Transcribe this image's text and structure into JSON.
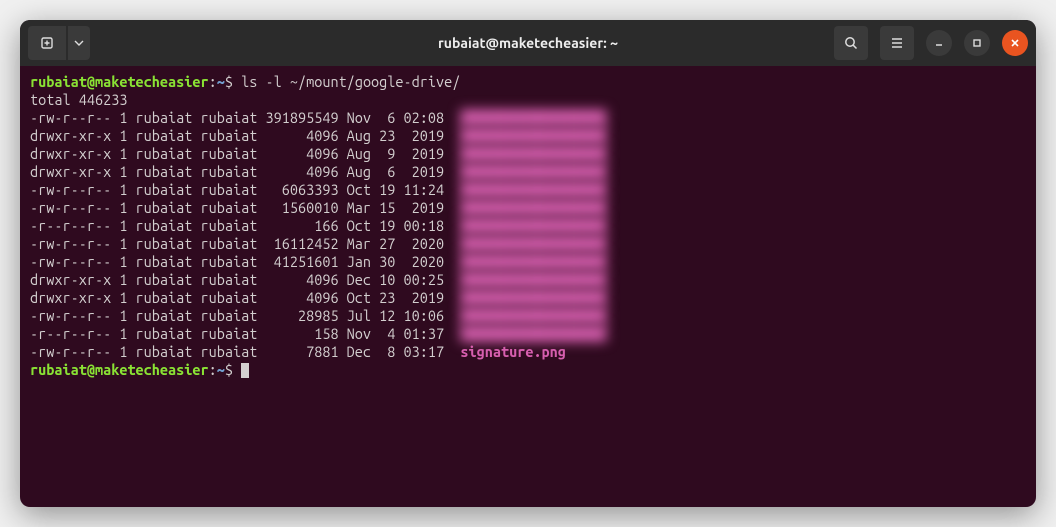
{
  "window": {
    "title": "rubaiat@maketecheasier: ~"
  },
  "prompt": {
    "user": "rubaiat@maketecheasier",
    "path": "~",
    "symbol": "$"
  },
  "command1": "ls -l ~/mount/google-drive/",
  "totalLine": "total 446233",
  "rows": [
    {
      "perm": "-rw-r--r--",
      "n": "1",
      "o": "rubaiat",
      "g": "rubaiat",
      "size": "391895549",
      "m": "Nov",
      "d": " 6",
      "t": "02:08",
      "blurred": true
    },
    {
      "perm": "drwxr-xr-x",
      "n": "1",
      "o": "rubaiat",
      "g": "rubaiat",
      "size": "4096",
      "m": "Aug",
      "d": "23",
      "t": " 2019",
      "blurred": true
    },
    {
      "perm": "drwxr-xr-x",
      "n": "1",
      "o": "rubaiat",
      "g": "rubaiat",
      "size": "4096",
      "m": "Aug",
      "d": " 9",
      "t": " 2019",
      "blurred": true
    },
    {
      "perm": "drwxr-xr-x",
      "n": "1",
      "o": "rubaiat",
      "g": "rubaiat",
      "size": "4096",
      "m": "Aug",
      "d": " 6",
      "t": " 2019",
      "blurred": true
    },
    {
      "perm": "-rw-r--r--",
      "n": "1",
      "o": "rubaiat",
      "g": "rubaiat",
      "size": "6063393",
      "m": "Oct",
      "d": "19",
      "t": "11:24",
      "blurred": true
    },
    {
      "perm": "-rw-r--r--",
      "n": "1",
      "o": "rubaiat",
      "g": "rubaiat",
      "size": "1560010",
      "m": "Mar",
      "d": "15",
      "t": " 2019",
      "blurred": true
    },
    {
      "perm": "-r--r--r--",
      "n": "1",
      "o": "rubaiat",
      "g": "rubaiat",
      "size": "166",
      "m": "Oct",
      "d": "19",
      "t": "00:18",
      "blurred": true
    },
    {
      "perm": "-rw-r--r--",
      "n": "1",
      "o": "rubaiat",
      "g": "rubaiat",
      "size": "16112452",
      "m": "Mar",
      "d": "27",
      "t": " 2020",
      "blurred": true
    },
    {
      "perm": "-rw-r--r--",
      "n": "1",
      "o": "rubaiat",
      "g": "rubaiat",
      "size": "41251601",
      "m": "Jan",
      "d": "30",
      "t": " 2020",
      "blurred": true
    },
    {
      "perm": "drwxr-xr-x",
      "n": "1",
      "o": "rubaiat",
      "g": "rubaiat",
      "size": "4096",
      "m": "Dec",
      "d": "10",
      "t": "00:25",
      "blurred": true
    },
    {
      "perm": "drwxr-xr-x",
      "n": "1",
      "o": "rubaiat",
      "g": "rubaiat",
      "size": "4096",
      "m": "Oct",
      "d": "23",
      "t": " 2019",
      "blurred": true
    },
    {
      "perm": "-rw-r--r--",
      "n": "1",
      "o": "rubaiat",
      "g": "rubaiat",
      "size": "28985",
      "m": "Jul",
      "d": "12",
      "t": "10:06",
      "blurred": true
    },
    {
      "perm": "-r--r--r--",
      "n": "1",
      "o": "rubaiat",
      "g": "rubaiat",
      "size": "158",
      "m": "Nov",
      "d": " 4",
      "t": "01:37",
      "blurred": true
    },
    {
      "perm": "-rw-r--r--",
      "n": "1",
      "o": "rubaiat",
      "g": "rubaiat",
      "size": "7881",
      "m": "Dec",
      "d": " 8",
      "t": "03:17",
      "file": "signature.png"
    }
  ]
}
